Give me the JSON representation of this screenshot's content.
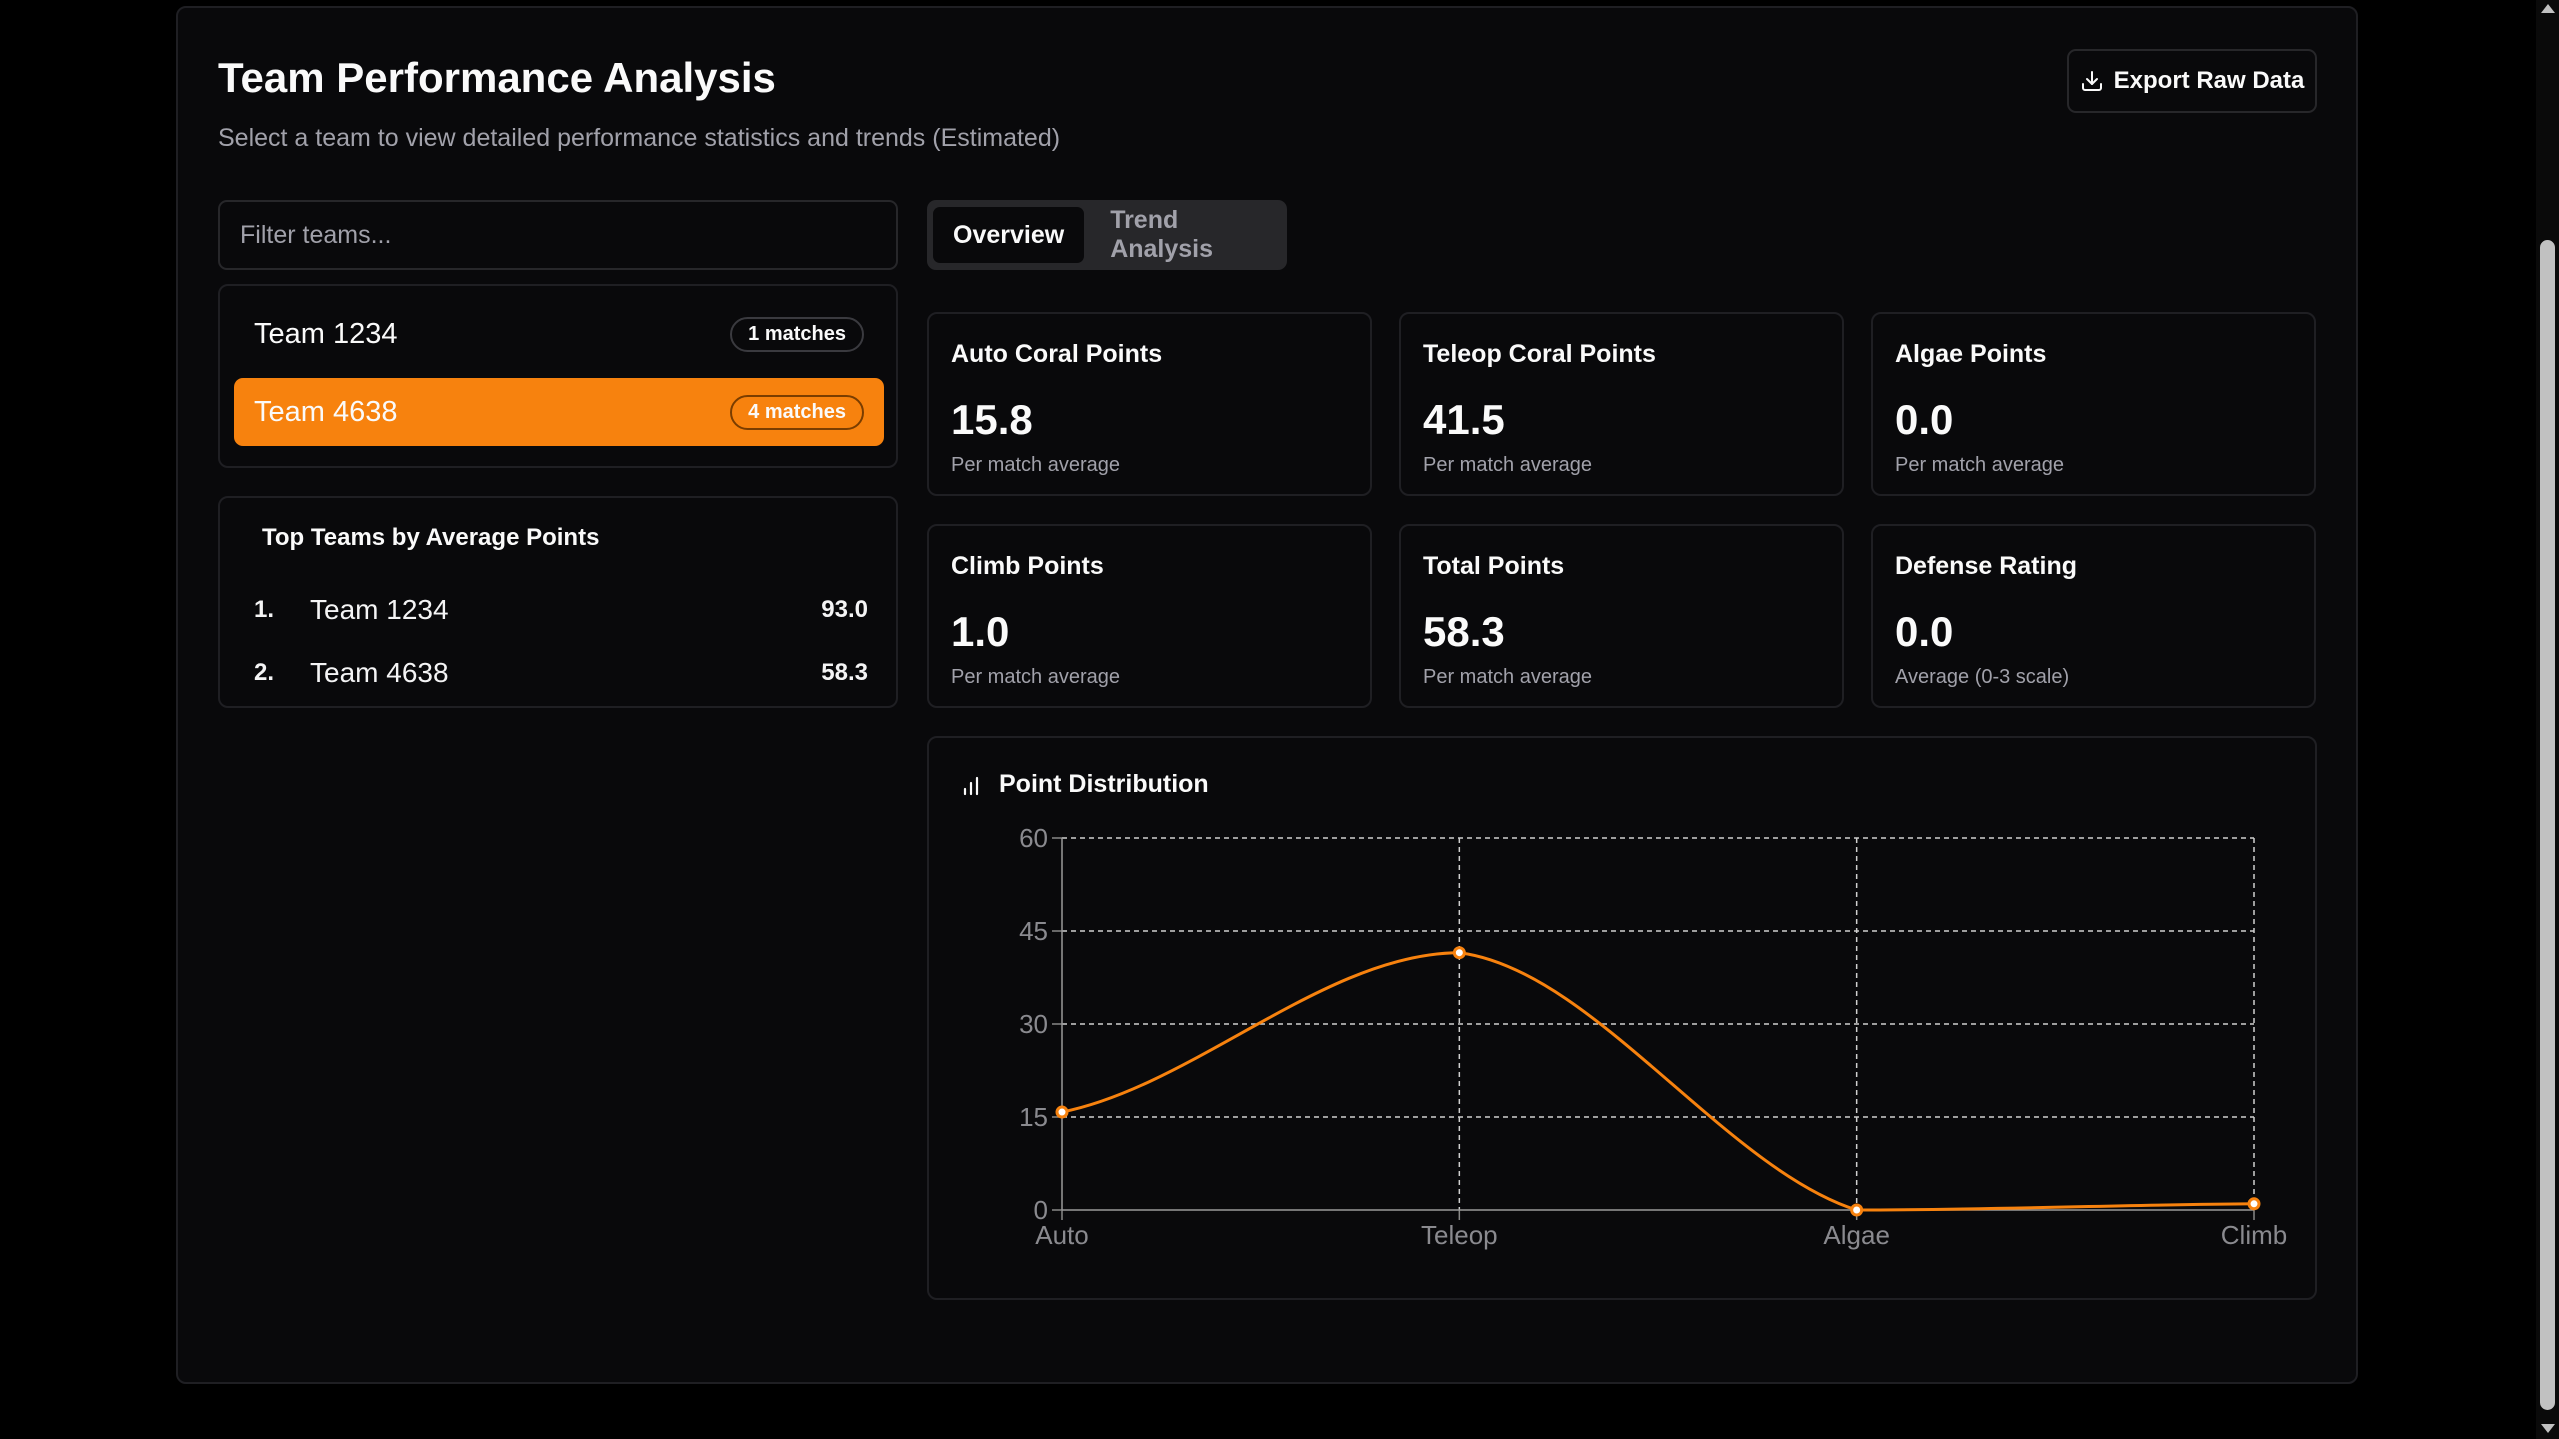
{
  "header": {
    "title": "Team Performance Analysis",
    "subtitle": "Select a team to view detailed performance statistics and trends (Estimated)",
    "export_label": "Export Raw Data"
  },
  "filter": {
    "placeholder": "Filter teams..."
  },
  "teams": [
    {
      "name": "Team 1234",
      "badge": "1 matches",
      "selected": false
    },
    {
      "name": "Team 4638",
      "badge": "4 matches",
      "selected": true
    }
  ],
  "top_teams": {
    "title": "Top Teams by Average Points",
    "rows": [
      {
        "rank": "1.",
        "name": "Team 1234",
        "value": "93.0"
      },
      {
        "rank": "2.",
        "name": "Team 4638",
        "value": "58.3"
      }
    ]
  },
  "tabs": [
    {
      "label": "Overview",
      "active": true
    },
    {
      "label": "Trend Analysis",
      "active": false
    }
  ],
  "stats": [
    {
      "label": "Auto Coral Points",
      "value": "15.8",
      "note": "Per match average"
    },
    {
      "label": "Teleop Coral Points",
      "value": "41.5",
      "note": "Per match average"
    },
    {
      "label": "Algae Points",
      "value": "0.0",
      "note": "Per match average"
    },
    {
      "label": "Climb Points",
      "value": "1.0",
      "note": "Per match average"
    },
    {
      "label": "Total Points",
      "value": "58.3",
      "note": "Per match average"
    },
    {
      "label": "Defense Rating",
      "value": "0.0",
      "note": "Average (0-3 scale)"
    }
  ],
  "chart": {
    "title": "Point Distribution",
    "icon": "bar-chart-icon"
  },
  "chart_data": {
    "type": "line",
    "title": "Point Distribution",
    "categories": [
      "Auto",
      "Teleop",
      "Algae",
      "Climb"
    ],
    "values": [
      15.8,
      41.5,
      0.0,
      1.0
    ],
    "ylim": [
      0,
      60
    ],
    "yticks": [
      "0",
      "15",
      "30",
      "45",
      "60"
    ],
    "grid": true,
    "color": "#f7820e"
  },
  "colors": {
    "accent": "#f7820e",
    "background": "#09090b",
    "border": "#27272a"
  }
}
